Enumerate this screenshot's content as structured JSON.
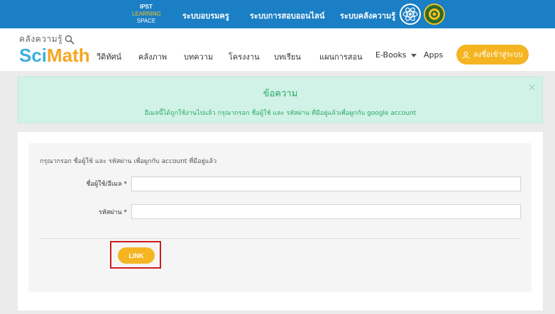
{
  "topbar": {
    "ipst": {
      "line1": "IPST",
      "line2": "LEARNING",
      "line3": "SPACE"
    },
    "links": [
      "ระบบอบรมครู",
      "ระบบการสอบออนไลน์",
      "ระบบคลังความรู้"
    ]
  },
  "brand": {
    "small": "คลังความรู้",
    "sci": "Sci",
    "math": "Math"
  },
  "nav": {
    "items": [
      "วีดิทัศน์",
      "คลังภาพ",
      "บทความ",
      "โครงงาน",
      "บทเรียน",
      "แผนการสอน",
      "E-Books",
      "Apps"
    ],
    "login_label": "ลงชื่อเข้าสู่ระบบ"
  },
  "alert": {
    "title": "ข้อความ",
    "message": "อีเมลนี้ได้ถูกใช้งานไปแล้ว กรุณากรอก ชื่อผู้ใช้ และ รหัสผ่าน ที่มีอยู่แล้วเพื่อผูกกับ google account",
    "close": "×"
  },
  "form": {
    "instruction": "กรุณากรอก ชื่อผู้ใช้ และ รหัสผ่าน เพื่อผูกกับ account ที่มีอยู่แล้ว",
    "username_label": "ชื่อผู้ใช้/อีเมล *",
    "username_value": "",
    "password_label": "รหัสผ่าน *",
    "password_value": "",
    "submit_label": "LINK"
  },
  "colors": {
    "topbar": "#1a7fc4",
    "accent": "#f5b523",
    "alert_bg": "#d1f2e6",
    "alert_text": "#27a968",
    "highlight": "#d01c1c"
  }
}
